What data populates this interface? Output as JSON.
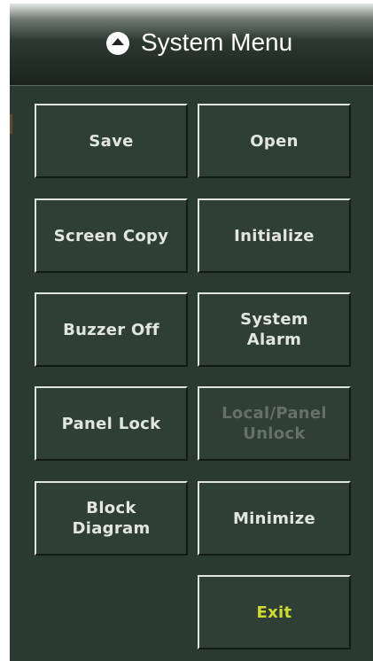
{
  "header": {
    "title": "System Menu",
    "icon": "chevron-up-circle-icon"
  },
  "buttons": {
    "save": "Save",
    "open": "Open",
    "screen_copy": "Screen Copy",
    "initialize": "Initialize",
    "buzzer_off": "Buzzer Off",
    "system_alarm": "System\nAlarm",
    "panel_lock": "Panel Lock",
    "local_panel_unlock": "Local/Panel\nUnlock",
    "block_diagram": "Block\nDiagram",
    "minimize": "Minimize",
    "exit": "Exit"
  },
  "colors": {
    "panel_background": "#2a3a31",
    "button_text": "#e2e6e2",
    "disabled_text": "#66706a",
    "exit_text": "#d2da32"
  }
}
